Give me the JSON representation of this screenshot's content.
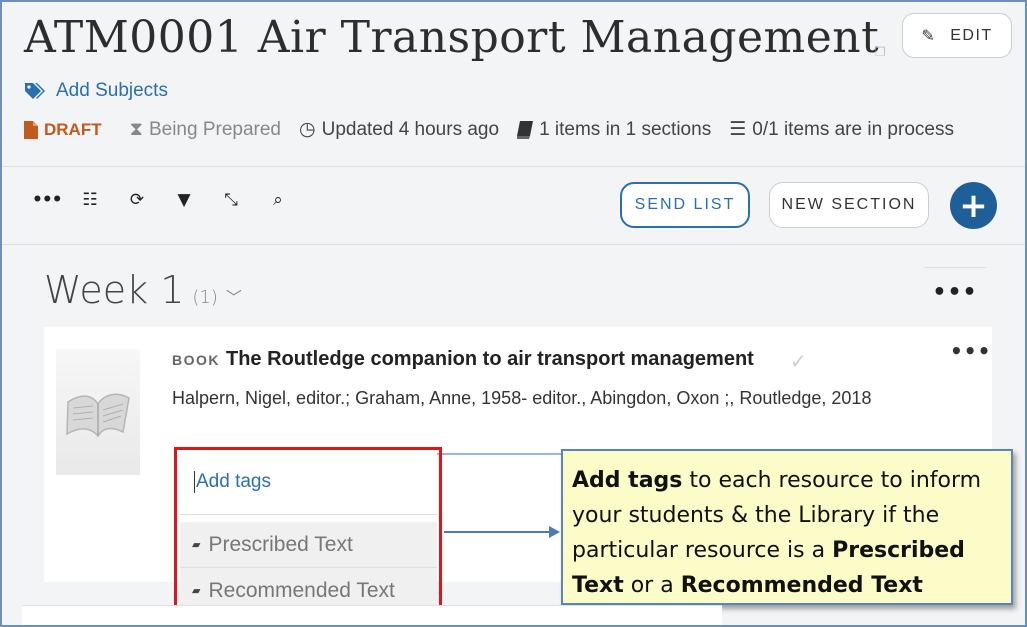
{
  "header": {
    "title": "ATM0001 Air Transport Management",
    "edit_label": "EDIT",
    "add_subjects": "Add Subjects"
  },
  "meta": {
    "status": "DRAFT",
    "stage": "Being Prepared",
    "updated": "Updated 4 hours ago",
    "items": "1 items in 1 sections",
    "process": "0/1 items are in process"
  },
  "toolbar": {
    "send_list": "SEND LIST",
    "new_section": "NEW SECTION",
    "add_symbol": "+"
  },
  "section": {
    "title": "Week 1",
    "count": "(1)"
  },
  "resource": {
    "type": "BOOK",
    "title": "The Routledge companion to air transport management",
    "authors": "Halpern, Nigel, editor.; Graham, Anne, 1958- editor., Abingdon, Oxon ;, Routledge, 2018"
  },
  "tags": {
    "input_placeholder": "Add tags",
    "options": [
      "Prescribed Text",
      "Recommended Text"
    ]
  },
  "callout": {
    "part1_bold": "Add tags",
    "part1": " to each resource to inform your students & the Library if the particular resource is a ",
    "part2_bold": "Prescribed Text",
    "part3": " or a ",
    "part4_bold": "Recommended Text"
  },
  "colors": {
    "accent": "#2a6fb0",
    "draft": "#c15a1d",
    "highlight_border": "#e0141a",
    "callout_bg": "#fcfcc9"
  }
}
